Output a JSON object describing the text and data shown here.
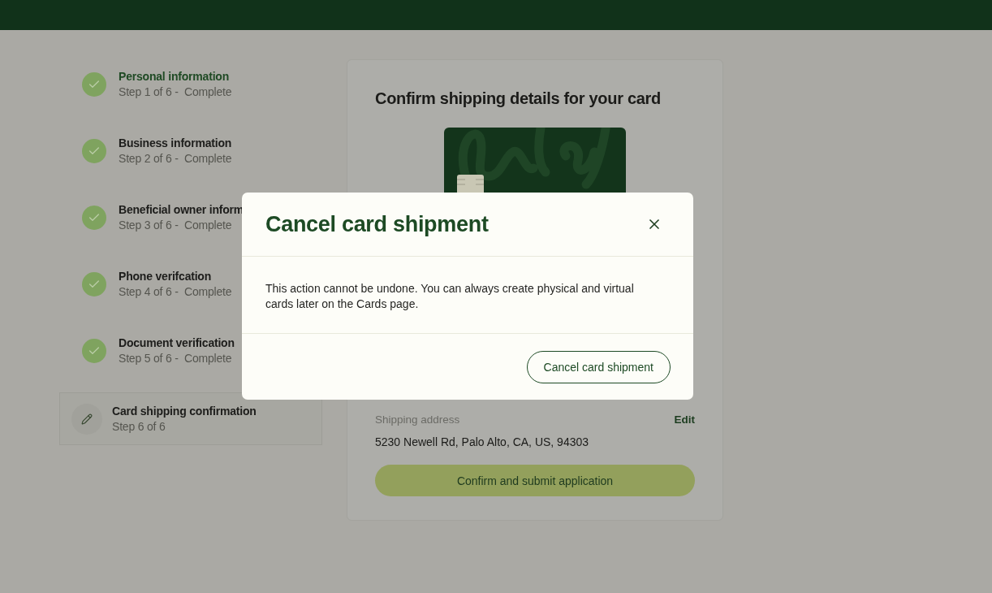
{
  "steps": [
    {
      "title": "Personal information",
      "subtitle": "Step 1 of 6 -  Complete",
      "kind": "complete",
      "emphasized": true,
      "selected": false
    },
    {
      "title": "Business information",
      "subtitle": "Step 2 of 6 -  Complete",
      "kind": "complete",
      "emphasized": false,
      "selected": false
    },
    {
      "title": "Beneficial owner inform",
      "subtitle": "Step 3 of 6 -  Complete",
      "kind": "complete",
      "emphasized": false,
      "selected": false
    },
    {
      "title": "Phone verifcation",
      "subtitle": "Step 4 of 6 -  Complete",
      "kind": "complete",
      "emphasized": false,
      "selected": false
    },
    {
      "title": "Document verification",
      "subtitle": "Step 5 of 6 -  Complete",
      "kind": "complete",
      "emphasized": false,
      "selected": false
    },
    {
      "title": "Card shipping confirmation",
      "subtitle": "Step 6 of 6",
      "kind": "current",
      "emphasized": false,
      "selected": true
    }
  ],
  "panel": {
    "title": "Confirm shipping details for your card",
    "shipping_label": "Shipping address",
    "edit_link": "Edit",
    "address": "5230 Newell Rd, Palo Alto, CA, US, 94303",
    "submit_button": "Confirm and submit application"
  },
  "modal": {
    "title": "Cancel card shipment",
    "message": "This action cannot be undone. You can always create physical and virtual cards later on the Cards page.",
    "button": "Cancel card shipment"
  }
}
